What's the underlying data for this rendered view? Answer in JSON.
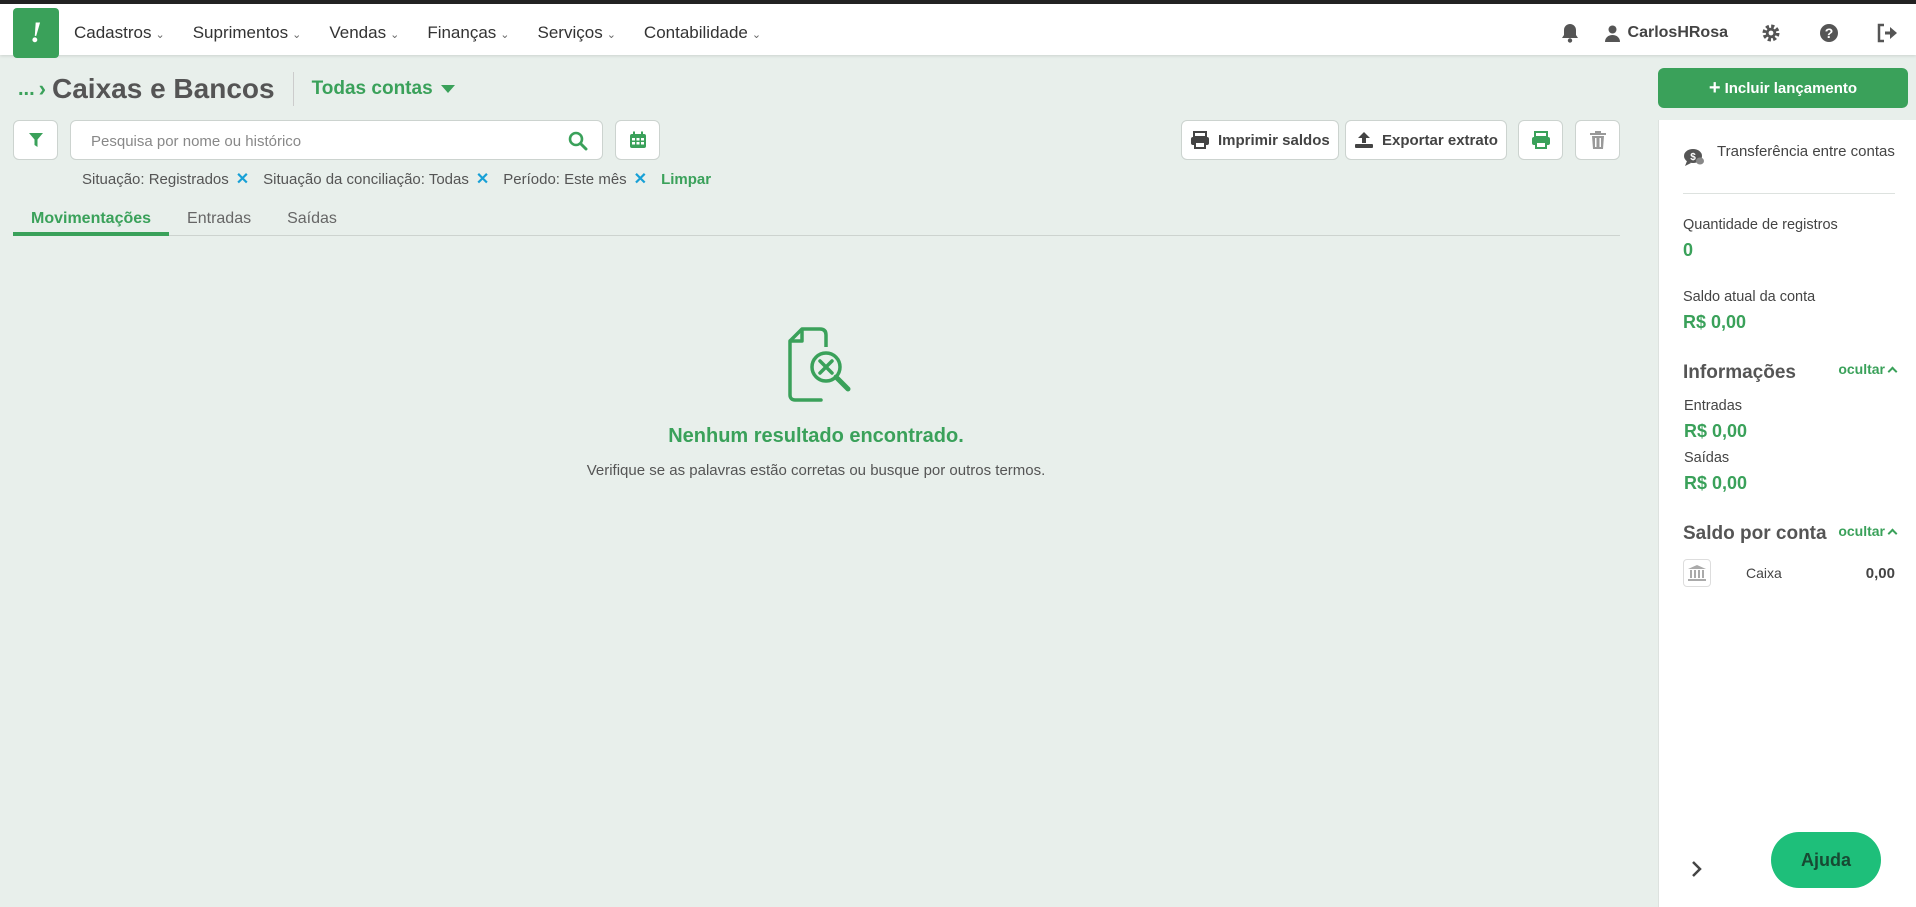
{
  "brand": {
    "logo_char": "!",
    "accent": "#3aa15a"
  },
  "nav": {
    "items": [
      {
        "label": "Cadastros"
      },
      {
        "label": "Suprimentos"
      },
      {
        "label": "Vendas"
      },
      {
        "label": "Finanças"
      },
      {
        "label": "Serviços"
      },
      {
        "label": "Contabilidade"
      }
    ],
    "user": "CarlosHRosa",
    "icons": [
      "bell-icon",
      "user-icon",
      "gear-icon",
      "question-icon",
      "logout-icon"
    ]
  },
  "header": {
    "breadcrumb_dots": "...",
    "title": "Caixas e Bancos",
    "account_filter": "Todas contas",
    "add_button": "Incluir lançamento"
  },
  "toolbar": {
    "search_placeholder": "Pesquisa por nome ou histórico",
    "print_balances": "Imprimir saldos",
    "export_statement": "Exportar extrato"
  },
  "filters": {
    "chips": [
      {
        "label": "Situação: Registrados"
      },
      {
        "label": "Situação da conciliação: Todas"
      },
      {
        "label": "Período: Este mês"
      }
    ],
    "clear": "Limpar"
  },
  "tabs": [
    {
      "label": "Movimentações",
      "active": true
    },
    {
      "label": "Entradas",
      "active": false
    },
    {
      "label": "Saídas",
      "active": false
    }
  ],
  "empty_state": {
    "title": "Nenhum resultado encontrado.",
    "subtitle": "Verifique se as palavras estão corretas ou busque por outros termos."
  },
  "panel": {
    "transfer_label": "Transferência entre contas",
    "records_label": "Quantidade de registros",
    "records_value": "0",
    "balance_label": "Saldo atual da conta",
    "balance_value": "R$ 0,00",
    "info_title": "Informações",
    "hide_label": "ocultar",
    "inflows_label": "Entradas",
    "inflows_value": "R$ 0,00",
    "outflows_label": "Saídas",
    "outflows_value": "R$ 0,00",
    "by_account_title": "Saldo por conta",
    "accounts": [
      {
        "name": "Caixa",
        "value": "0,00"
      }
    ],
    "help_button": "Ajuda"
  }
}
